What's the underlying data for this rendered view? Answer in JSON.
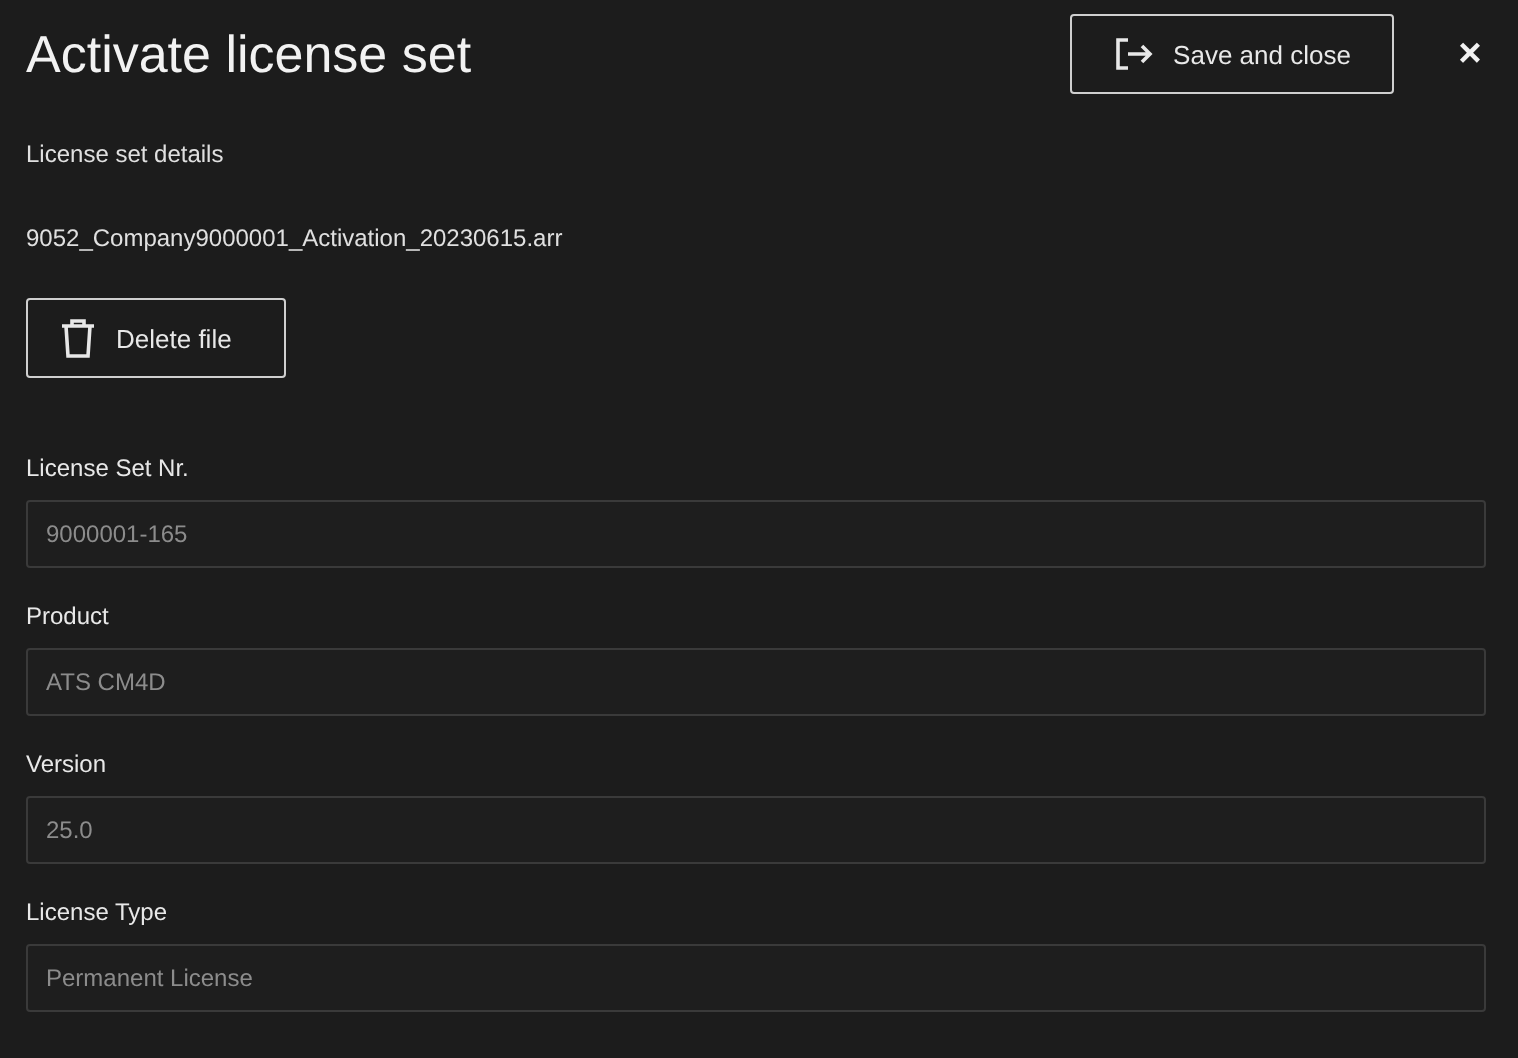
{
  "dialog": {
    "title": "Activate license set",
    "save_button": "Save and close",
    "close_button": "×"
  },
  "section_label": "License set details",
  "file_name": "9052_Company9000001_Activation_20230615.arr",
  "delete_button": "Delete file",
  "fields": [
    {
      "label": "License Set Nr.",
      "value": "9000001-165",
      "disabled": true
    },
    {
      "label": "Product",
      "value": "ATS CM4D",
      "disabled": true
    },
    {
      "label": "Version",
      "value": "25.0",
      "disabled": true
    },
    {
      "label": "License Type",
      "value": "Permanent License",
      "disabled": true
    }
  ]
}
